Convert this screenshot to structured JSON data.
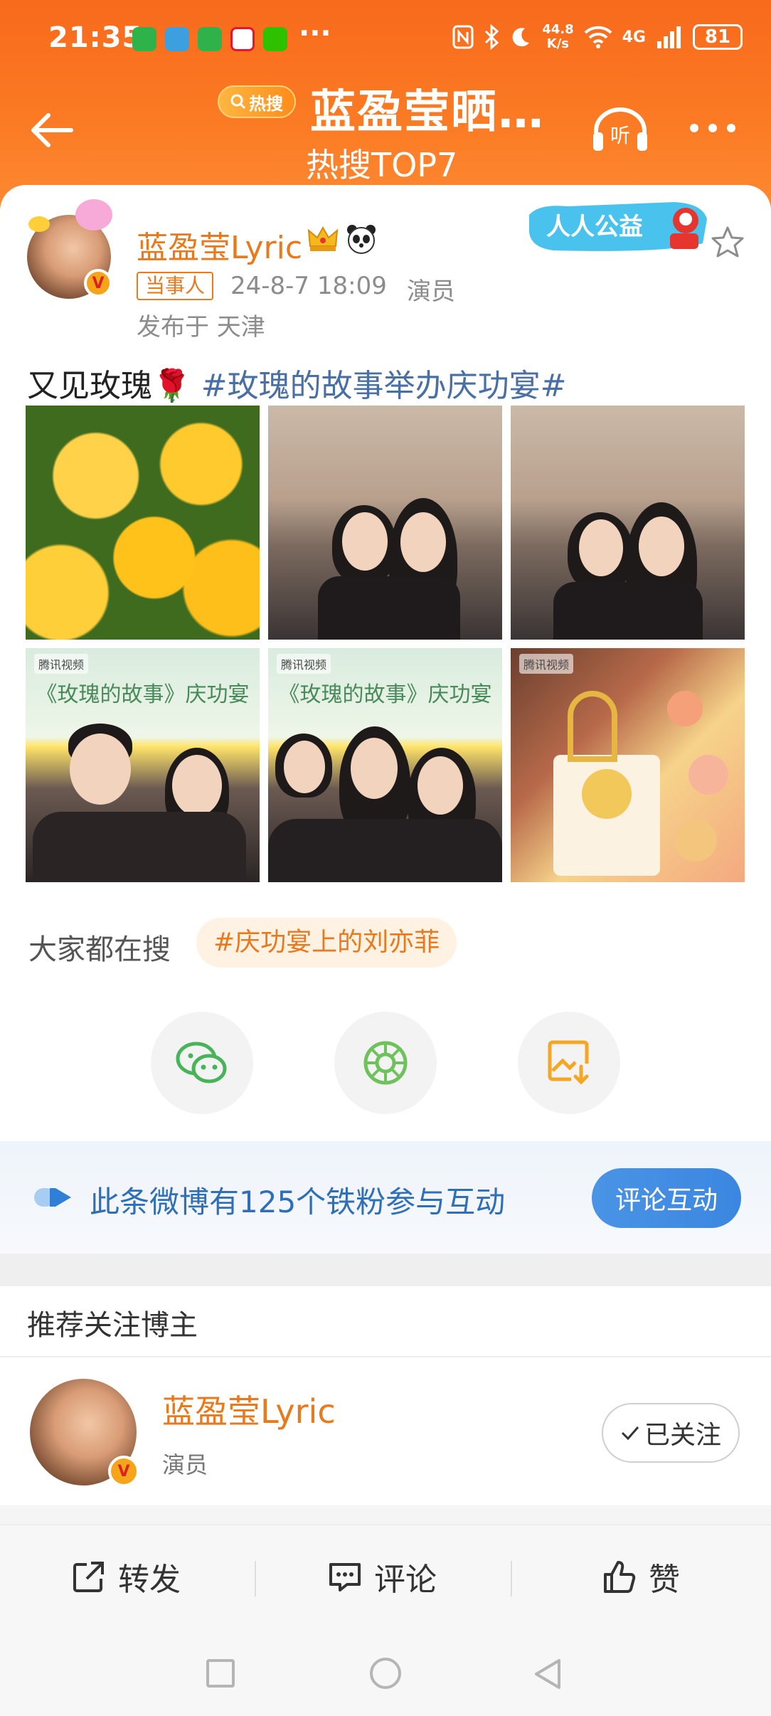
{
  "status_bar": {
    "time": "21:35",
    "dots": "···",
    "speed_value": "44.8",
    "speed_unit": "K/s",
    "network": "4G",
    "battery": "81"
  },
  "nav": {
    "hot_badge": "热搜",
    "title": "蓝盈莹晒…",
    "subtitle": "热搜TOP7",
    "listen_label": "听"
  },
  "post": {
    "author": "蓝盈莹Lyric",
    "verified_mark": "V",
    "tag": "当事人",
    "time": "24-8-7 18:09",
    "role": "演员",
    "location": "发布于 天津",
    "charity_badge": "人人公益",
    "text": "又见玫瑰🌹",
    "hashtag": "#玫瑰的故事举办庆功宴#",
    "photo_banner_text": "《玫瑰的故事》庆功宴",
    "photo_watermark": "腾讯视频"
  },
  "search": {
    "label": "大家都在搜",
    "chip": "#庆功宴上的刘亦菲"
  },
  "share": {
    "items": [
      {
        "name": "wechat",
        "color": "#49b35a"
      },
      {
        "name": "moments",
        "color": "#6ec25c"
      },
      {
        "name": "save-image",
        "color": "#f5a623"
      }
    ]
  },
  "fans": {
    "text": "此条微博有125个铁粉参与互动",
    "button": "评论互动"
  },
  "recommend": {
    "title": "推荐关注博主",
    "name": "蓝盈莹Lyric",
    "role": "演员",
    "follow_label": "已关注"
  },
  "actions": {
    "repost": "转发",
    "comment": "评论",
    "like": "赞"
  },
  "colors": {
    "brand_orange": "#f86a1c",
    "name_orange": "#e8791c",
    "link_blue": "#4a6fa5",
    "fans_blue": "#2f6fb8"
  }
}
